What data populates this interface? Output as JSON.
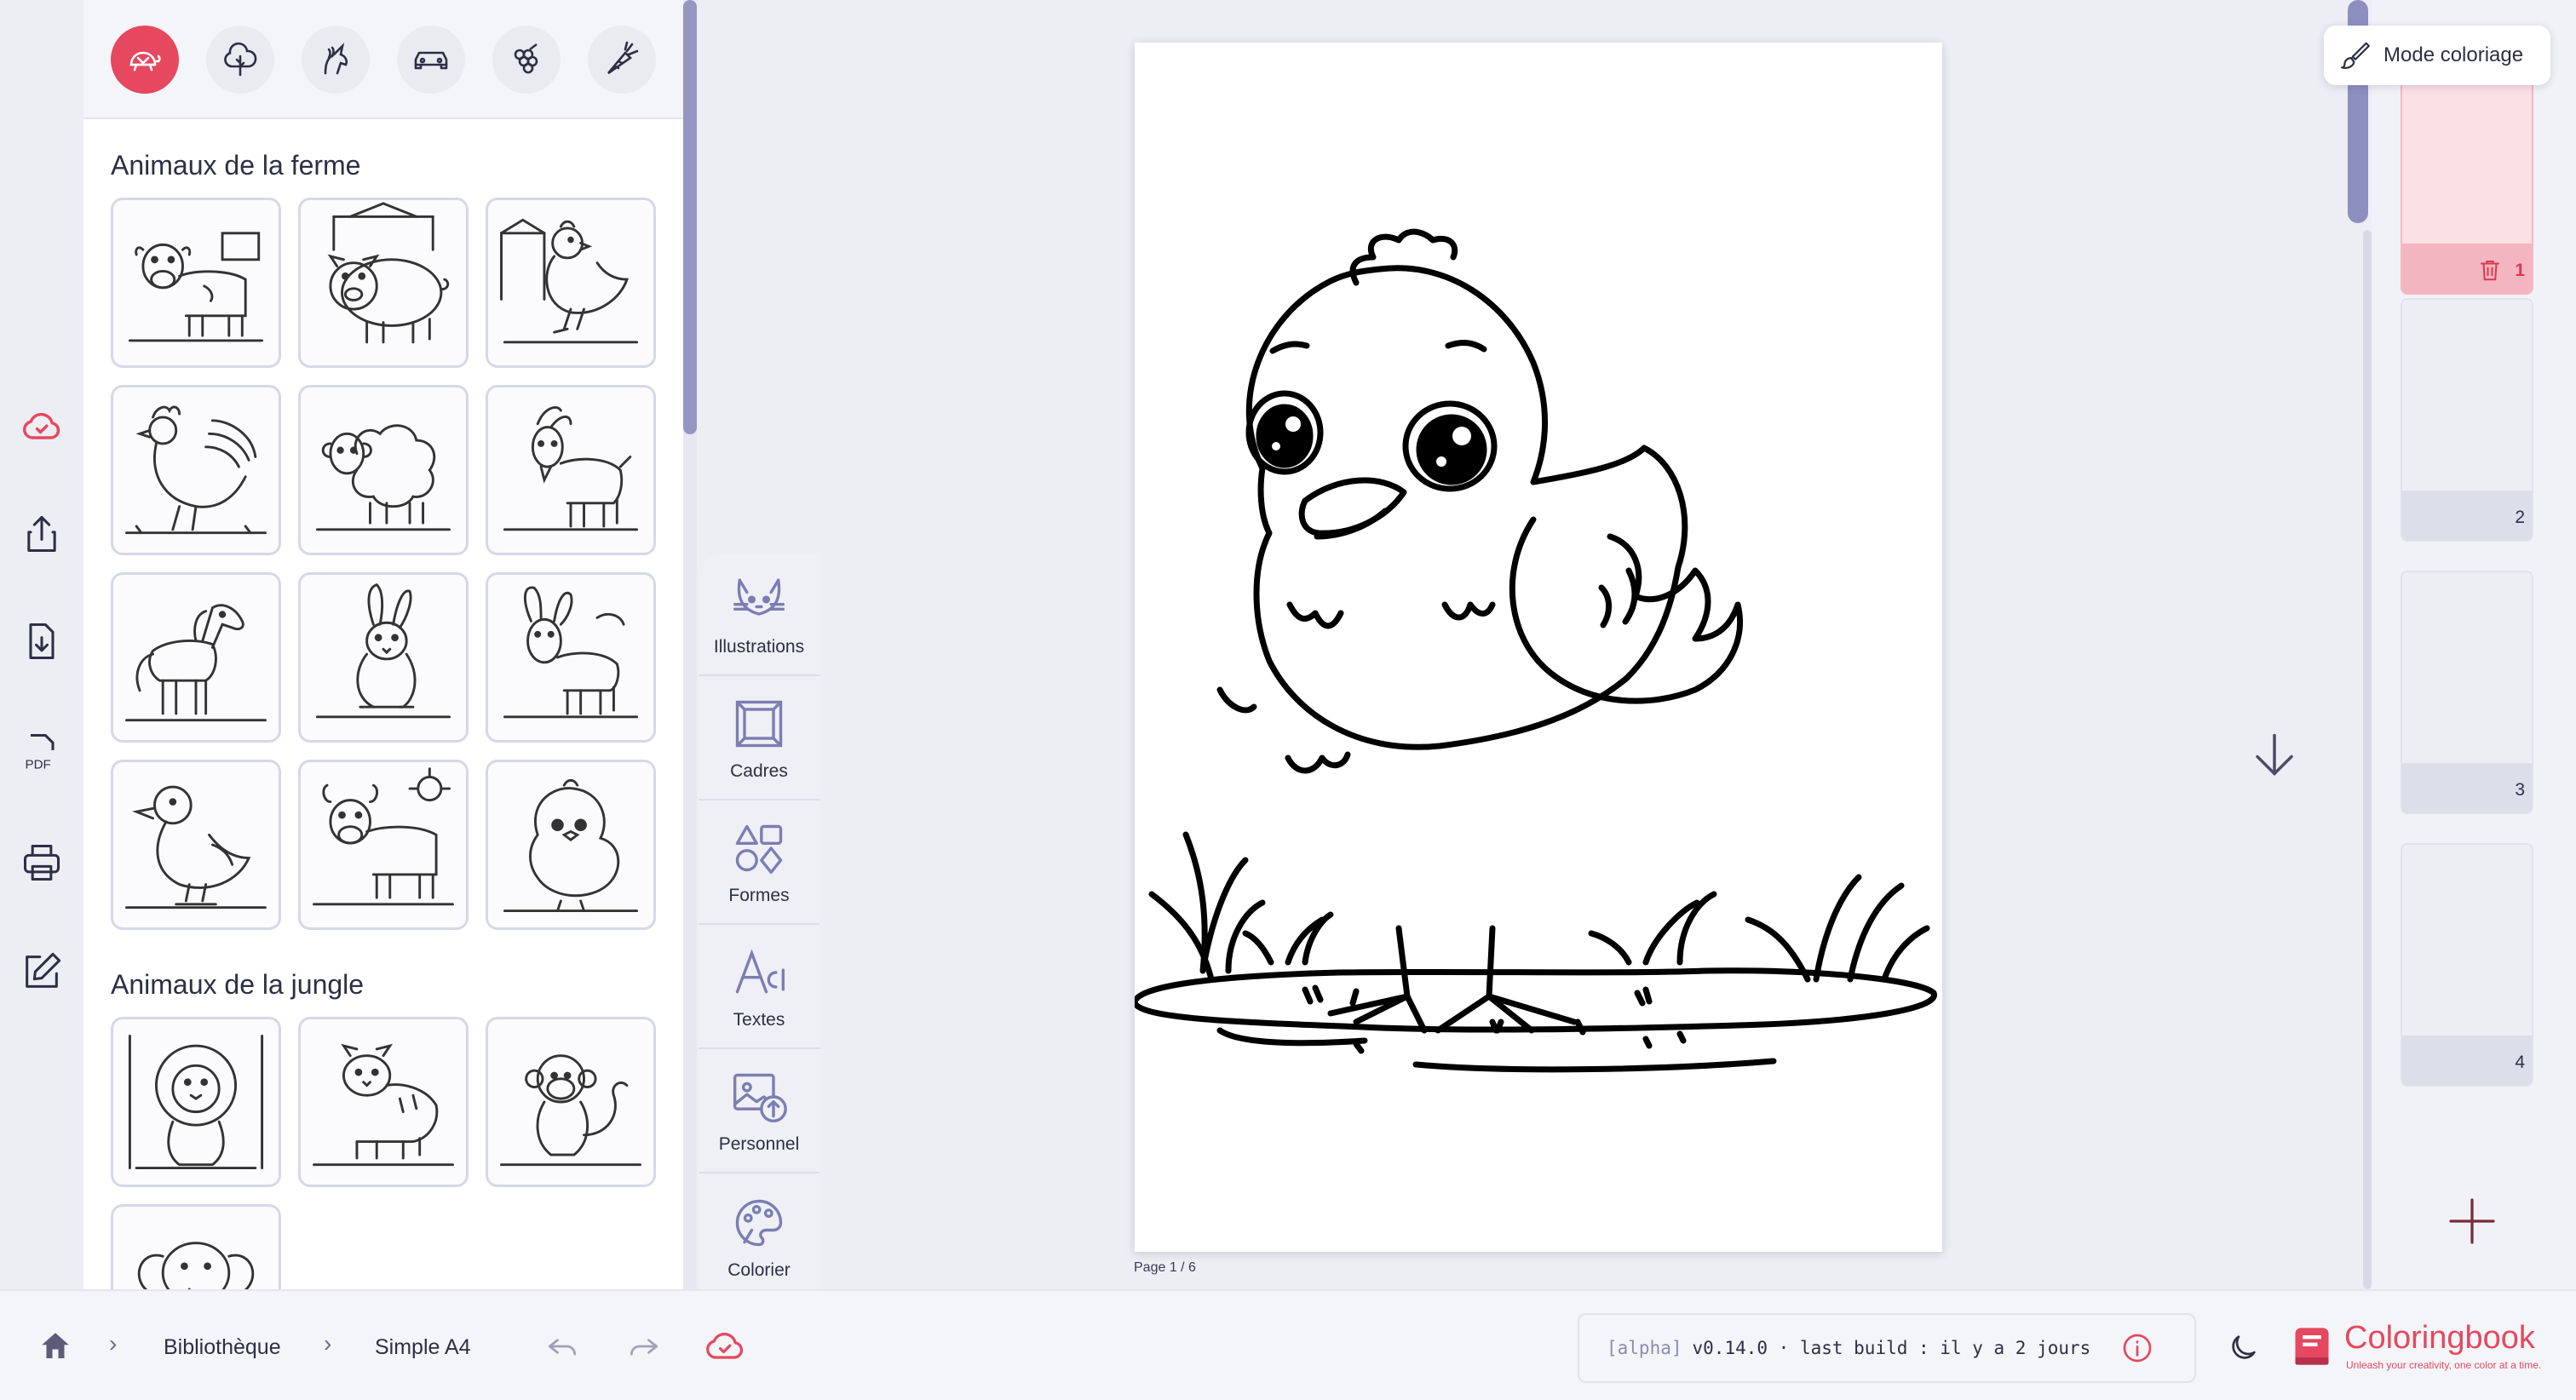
{
  "library": {
    "categories": [
      {
        "name": "turtle",
        "active": true
      },
      {
        "name": "tree",
        "active": false
      },
      {
        "name": "unicorn",
        "active": false
      },
      {
        "name": "car",
        "active": false
      },
      {
        "name": "grapes",
        "active": false
      },
      {
        "name": "carrot",
        "active": false
      }
    ],
    "sections": [
      {
        "title": "Animaux de la ferme",
        "items": [
          "cow",
          "pig",
          "hen",
          "rooster",
          "sheep",
          "goat",
          "horse",
          "rabbit",
          "donkey",
          "duck",
          "bull",
          "chick"
        ]
      },
      {
        "title": "Animaux de la jungle",
        "items": [
          "lion",
          "tiger",
          "monkey",
          "elephant"
        ]
      }
    ]
  },
  "tools": [
    {
      "label": "Illustrations",
      "icon": "cat-icon"
    },
    {
      "label": "Cadres",
      "icon": "frame-icon"
    },
    {
      "label": "Formes",
      "icon": "shapes-icon"
    },
    {
      "label": "Textes",
      "icon": "text-icon"
    },
    {
      "label": "Personnel",
      "icon": "image-upload-icon"
    },
    {
      "label": "Colorier",
      "icon": "palette-icon"
    }
  ],
  "canvas": {
    "page_indicator": "Page 1 / 6",
    "illustration": "chick"
  },
  "pages_panel": {
    "mode_button": "Mode coloriage",
    "pages": [
      {
        "number": "1",
        "active": true
      },
      {
        "number": "2",
        "active": false
      },
      {
        "number": "3",
        "active": false
      },
      {
        "number": "4",
        "active": false
      }
    ]
  },
  "bottombar": {
    "breadcrumbs": [
      "Bibliothèque",
      "Simple A4"
    ],
    "version_tag": "[alpha]",
    "version_text": "v0.14.0 · last build : il y a 2 jours",
    "brand_name": "Coloringbook",
    "brand_tagline": "Unleash your creativity, one color at a time."
  },
  "colors": {
    "accent": "#e5485f",
    "ink": "#2d2f45",
    "panel": "#f4f5f9",
    "scroll": "#9596c2"
  }
}
